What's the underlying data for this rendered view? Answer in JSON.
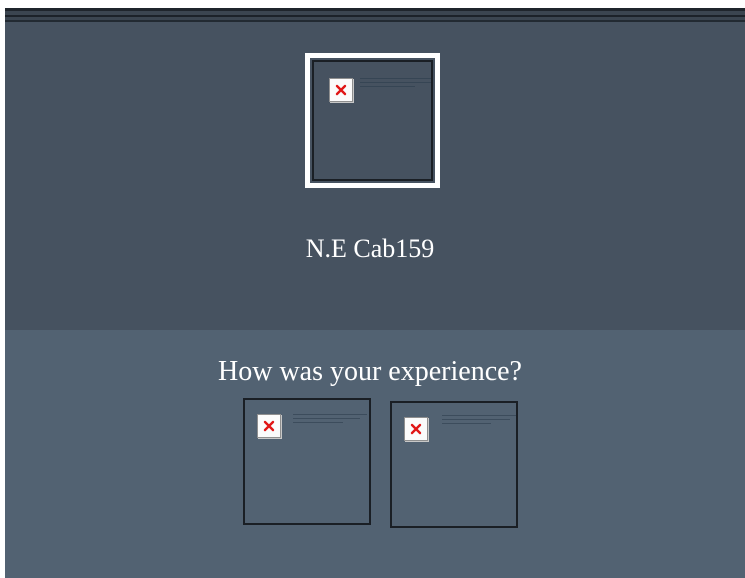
{
  "driver": {
    "name": "N.E Cab159",
    "photo_icon": "broken-image-icon"
  },
  "feedback": {
    "question": "How was your experience?",
    "options": [
      {
        "icon": "broken-image-icon"
      },
      {
        "icon": "broken-image-icon"
      }
    ]
  },
  "colors": {
    "header_bg": "#465260",
    "footer_bg": "#526272",
    "text": "#ffffff"
  }
}
